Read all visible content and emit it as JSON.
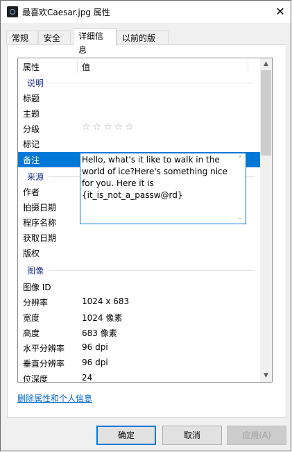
{
  "window": {
    "title": "最喜欢Caesar.jpg 属性",
    "close_glyph": "✕"
  },
  "tabs": [
    {
      "label": "常规"
    },
    {
      "label": "安全"
    },
    {
      "label": "详细信息"
    },
    {
      "label": "以前的版本"
    }
  ],
  "list": {
    "col_property": "属性",
    "col_value": "值",
    "groups": {
      "description": "说明",
      "origin": "来源",
      "image": "图像"
    },
    "rows": {
      "title": {
        "k": "标题",
        "v": ""
      },
      "subject": {
        "k": "主题",
        "v": ""
      },
      "rating": {
        "k": "分级",
        "stars": "☆☆☆☆☆"
      },
      "tags": {
        "k": "标记",
        "v": ""
      },
      "comments": {
        "k": "备注"
      },
      "author": {
        "k": "作者"
      },
      "date_taken": {
        "k": "拍摄日期"
      },
      "program": {
        "k": "程序名称"
      },
      "date_acquired": {
        "k": "获取日期"
      },
      "copyright": {
        "k": "版权"
      },
      "image_id": {
        "k": "图像 ID",
        "v": ""
      },
      "dimensions": {
        "k": "分辨率",
        "v": "1024 x 683"
      },
      "width": {
        "k": "宽度",
        "v": "1024 像素"
      },
      "height": {
        "k": "高度",
        "v": "683 像素"
      },
      "hres": {
        "k": "水平分辨率",
        "v": "96 dpi"
      },
      "vres": {
        "k": "垂直分辨率",
        "v": "96 dpi"
      },
      "bitdepth": {
        "k": "位深度",
        "v": "24"
      }
    }
  },
  "comment_editor": {
    "text": "Hello, what's it like to walk in the world of ice?Here's something nice for you. Here it is {it_is_not_a_passw@rd}"
  },
  "remove_link": "删除属性和个人信息",
  "buttons": {
    "ok": "确定",
    "cancel": "取消",
    "apply": "应用(A)"
  },
  "colors": {
    "selection": "#0078d7",
    "group_text": "#1e3287",
    "link": "#0066cc"
  }
}
